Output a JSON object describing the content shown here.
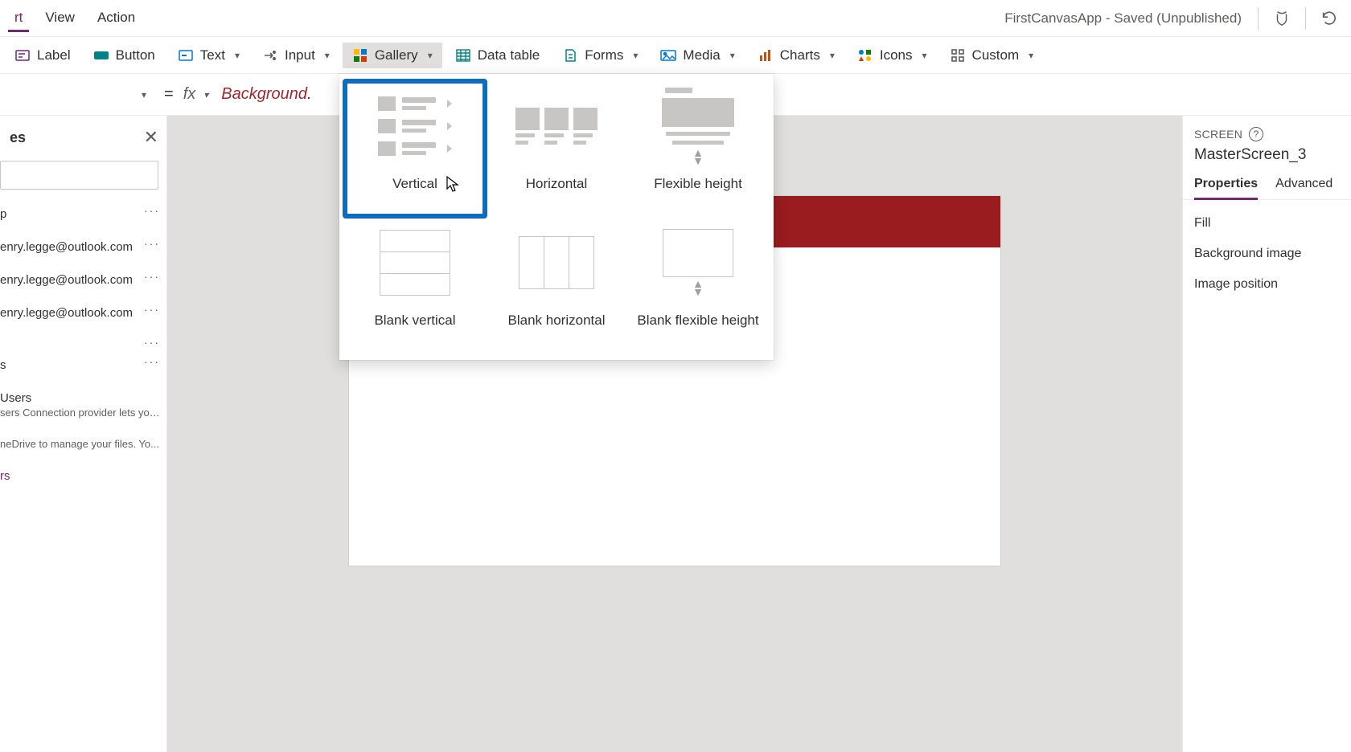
{
  "menubar": {
    "tabs": [
      {
        "label": "rt"
      },
      {
        "label": "View"
      },
      {
        "label": "Action"
      }
    ],
    "app_title": "FirstCanvasApp - Saved (Unpublished)"
  },
  "ribbon": {
    "label_btn": "Label",
    "button_btn": "Button",
    "text_btn": "Text",
    "input_btn": "Input",
    "gallery_btn": "Gallery",
    "datatable_btn": "Data table",
    "forms_btn": "Forms",
    "media_btn": "Media",
    "charts_btn": "Charts",
    "icons_btn": "Icons",
    "custom_btn": "Custom"
  },
  "formula": {
    "prefix": "Background",
    "suffix": "."
  },
  "left_panel": {
    "title": "es",
    "items": [
      {
        "ln1": "p",
        "dots": true
      },
      {
        "ln1": "enry.legge@outlook.com",
        "dots": true
      },
      {
        "ln1": "enry.legge@outlook.com",
        "dots": true
      },
      {
        "ln1": "enry.legge@outlook.com",
        "dots": true
      },
      {
        "ln1": "",
        "dots": true
      },
      {
        "ln1": "s",
        "dots": true
      },
      {
        "ln1": "Users",
        "ln2": "sers Connection provider lets you ...",
        "dots": false
      },
      {
        "ln1": "",
        "ln2": "neDrive to manage your files. Yo...",
        "dots": false
      },
      {
        "ln1": "rs",
        "purple": true,
        "dots": false
      }
    ]
  },
  "gallery_menu": {
    "items": [
      {
        "id": "vertical",
        "label": "Vertical",
        "selected": true
      },
      {
        "id": "horizontal",
        "label": "Horizontal"
      },
      {
        "id": "flexible",
        "label": "Flexible height"
      },
      {
        "id": "blank_vertical",
        "label": "Blank vertical"
      },
      {
        "id": "blank_horizontal",
        "label": "Blank horizontal"
      },
      {
        "id": "blank_flexible",
        "label": "Blank flexible height"
      }
    ]
  },
  "right_panel": {
    "hdr": "SCREEN",
    "screen_name": "MasterScreen_3",
    "tabs": {
      "properties": "Properties",
      "advanced": "Advanced"
    },
    "props": [
      "Fill",
      "Background image",
      "Image position"
    ]
  }
}
